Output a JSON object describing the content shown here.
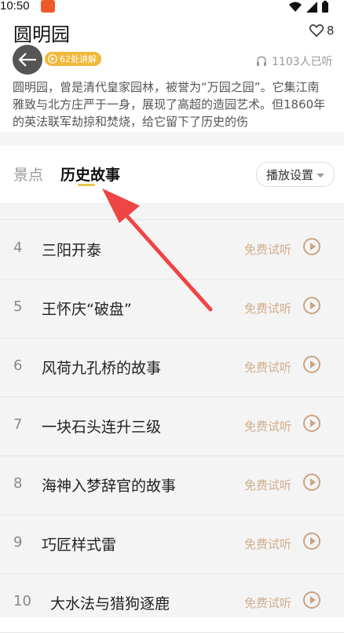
{
  "status_bar": {
    "time": "10:50"
  },
  "header": {
    "title": "圆明园",
    "favorite_count": "8",
    "badge_label": "62处讲解",
    "listeners_label": "1103人已听"
  },
  "description": "圆明园，曾是清代皇家园林，被誉为“万园之园”。它集江南雅致与北方庄严于一身，展现了高超的造园艺术。但1860年的英法联军劫掠和焚烧，给它留下了历史的伤",
  "tabs": [
    {
      "label": "景点",
      "active": false
    },
    {
      "label": "历史故事",
      "active": true
    }
  ],
  "play_settings_label": "播放设置",
  "free_label": "免费试听",
  "stories": [
    {
      "num": "4",
      "title": "三阳开泰"
    },
    {
      "num": "5",
      "title": "王怀庆“破盘”"
    },
    {
      "num": "6",
      "title": "风荷九孔桥的故事"
    },
    {
      "num": "7",
      "title": "一块石头连升三级"
    },
    {
      "num": "8",
      "title": "海神入梦辞官的故事"
    },
    {
      "num": "9",
      "title": "巧匠样式雷"
    },
    {
      "num": "10",
      "title": "大水法与猎狗逐鹿"
    }
  ],
  "colors": {
    "accent": "#f1b83a",
    "free_text": "#cfae8b",
    "annotation_arrow": "#ee4545"
  }
}
